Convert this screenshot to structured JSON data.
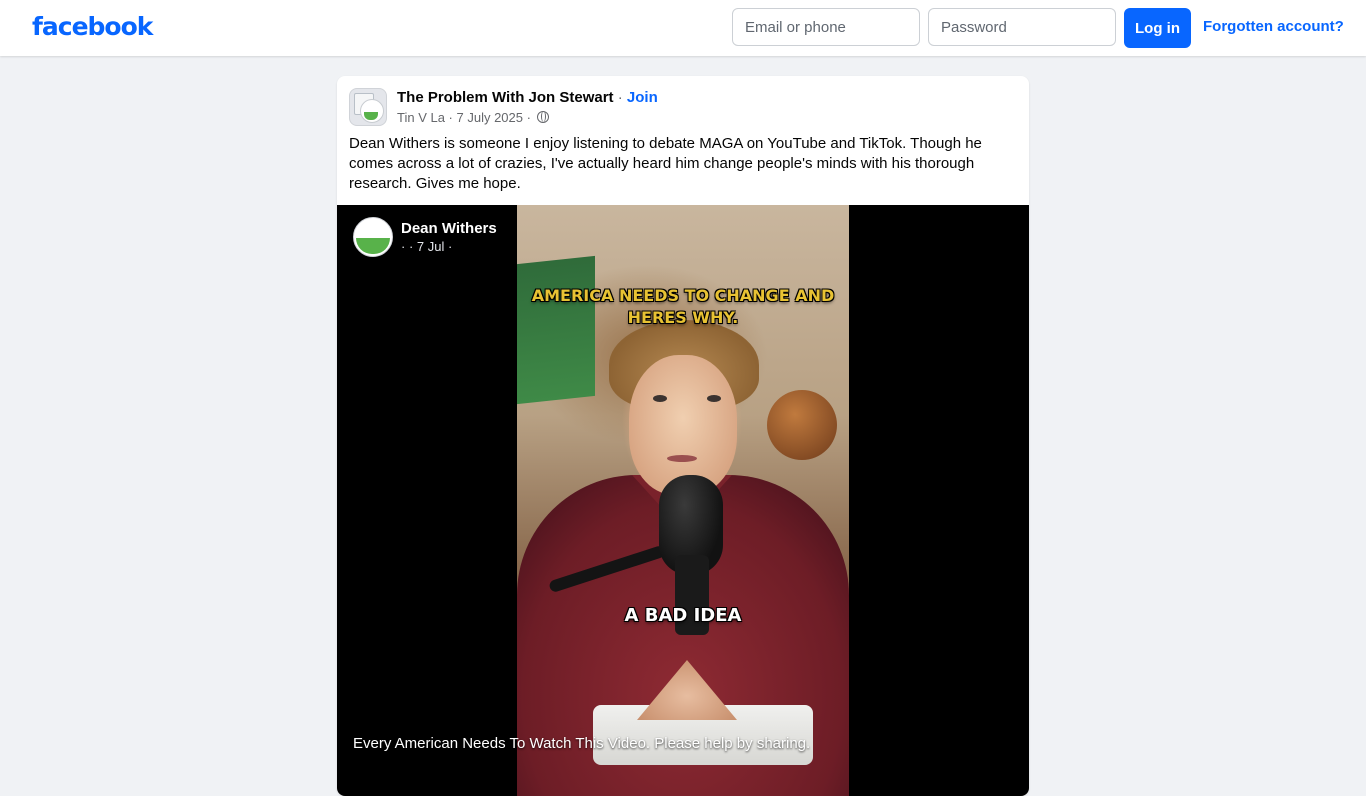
{
  "header": {
    "logo": "facebook",
    "email_placeholder": "Email or phone",
    "password_placeholder": "Password",
    "login_label": "Log in",
    "forgot_label": "Forgotten account?"
  },
  "post": {
    "group_name": "The Problem With Jon Stewart",
    "separator": " · ",
    "join_label": "Join",
    "author": "Tin V La",
    "date": "7 July 2025",
    "meta_separator": " · ",
    "text": "Dean Withers is someone I enjoy listening to debate MAGA on YouTube and TikTok. Though he comes across a lot of crazies, I've actually heard him change people's minds with his thorough research. Gives me hope."
  },
  "video": {
    "author": "Dean Withers",
    "date": "· · 7 Jul ·",
    "caption_top": "AMERICA NEEDS TO CHANGE AND HERES WHY.",
    "caption_mid": "A BAD IDEA",
    "description": "Every American Needs To Watch This Video. Please help by sharing."
  }
}
